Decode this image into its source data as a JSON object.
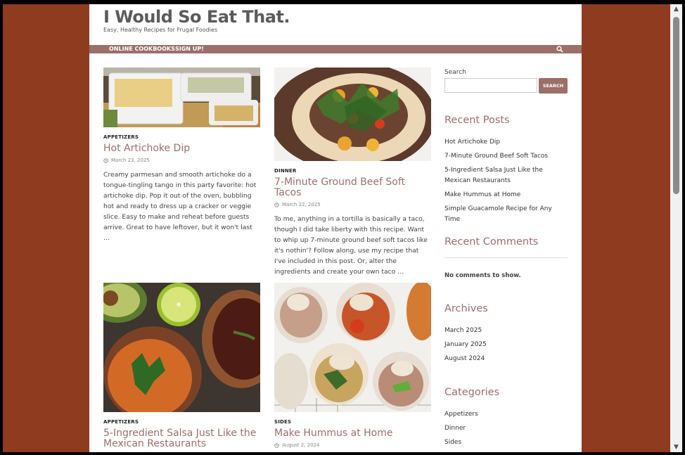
{
  "site": {
    "title": "I Would So Eat That.",
    "tagline": "Easy, Healthy Recipes for Frugal Foodies"
  },
  "nav": {
    "items": [
      "ONLINE COOKBOOKS",
      "SIGN UP!"
    ],
    "search_icon": "search-icon"
  },
  "posts": [
    {
      "category": "APPETIZERS",
      "title": "Hot Artichoke Dip",
      "date": "March 23, 2025",
      "excerpt": "Creamy parmesan and smooth artichoke do a tongue-tingling tango in this party favorite: hot artichoke dip. Pop it out of the oven, bubbling hot and ready to dress up a cracker or veggie slice. Easy to make and reheat before guests arrive. Great to have leftover, but it won't last …"
    },
    {
      "category": "DINNER",
      "title": "7-Minute Ground Beef Soft Tacos",
      "date": "March 22, 2025",
      "excerpt": "To me, anything in a tortilla is basically a taco, though I did take liberty with this recipe. Want to whip up 7-minute ground beef soft tacos like it's nothin'? Follow along, use my recipe that I've included in this post. Or, alter the ingredients and create your own taco …"
    },
    {
      "category": "APPETIZERS",
      "title": "5-Ingredient Salsa Just Like the Mexican Restaurants",
      "date": "",
      "excerpt": ""
    },
    {
      "category": "SIDES",
      "title": "Make Hummus at Home",
      "date": "August 2, 2024",
      "excerpt": ""
    }
  ],
  "sidebar": {
    "search_label": "Search",
    "search_placeholder": "",
    "search_button": "SEARCH",
    "recent_posts_heading": "Recent Posts",
    "recent_posts": [
      "Hot Artichoke Dip",
      "7-Minute Ground Beef Soft Tacos",
      "5-Ingredient Salsa Just Like the Mexican Restaurants",
      "Make Hummus at Home",
      "Simple Guacamole Recipe for Any Time"
    ],
    "recent_comments_heading": "Recent Comments",
    "no_comments": "No comments to show.",
    "archives_heading": "Archives",
    "archives": [
      "March 2025",
      "January 2025",
      "August 2024"
    ],
    "categories_heading": "Categories",
    "categories": [
      "Appetizers",
      "Dinner",
      "Sides"
    ]
  },
  "colors": {
    "background": "#8e3b20",
    "accent": "#9c6f6a"
  }
}
